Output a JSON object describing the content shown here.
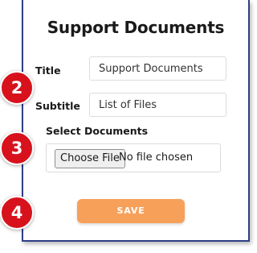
{
  "form": {
    "title": "Support Documents",
    "title_label": "Title",
    "title_value": "Support Documents",
    "subtitle_label": "Subtitle",
    "subtitle_value": "List of Files",
    "documents_label": "Select Documents",
    "file_button_label": "Choose File",
    "file_status": "No file chosen",
    "save_label": "SAVE"
  },
  "steps": [
    "2",
    "3",
    "4"
  ],
  "colors": {
    "border": "#2f3f86",
    "save_button": "#f7a05a",
    "step_badge": "#d7121c"
  }
}
